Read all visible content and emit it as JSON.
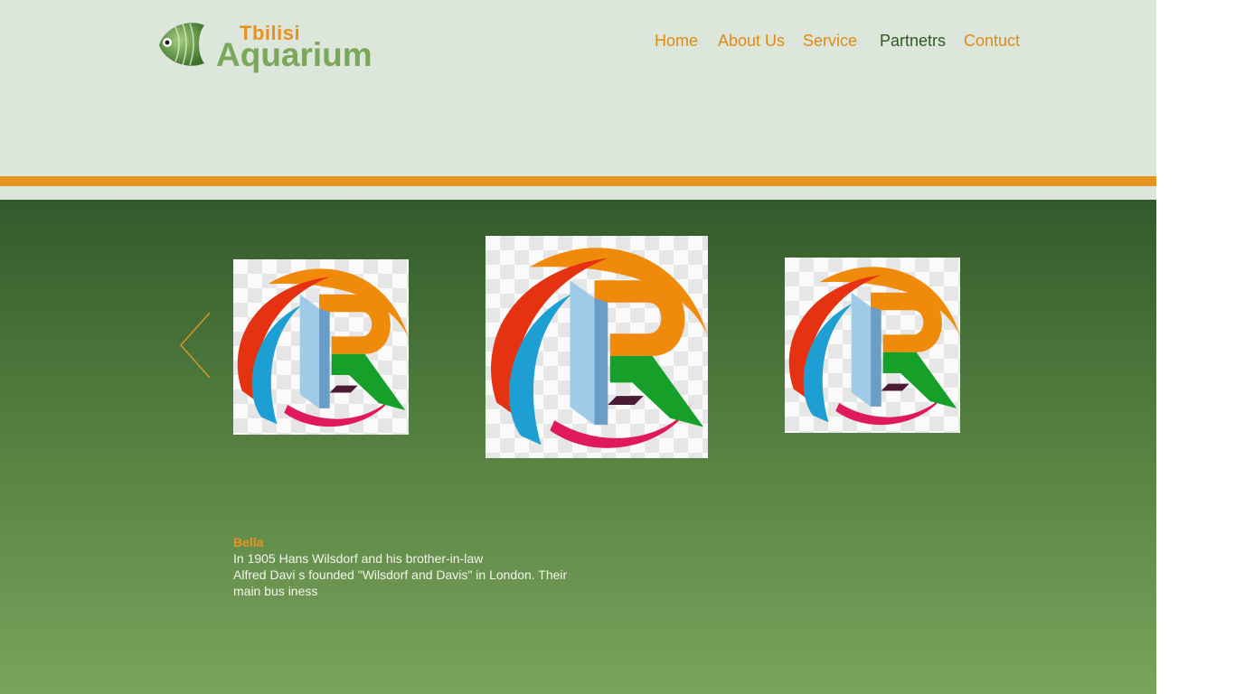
{
  "brand": {
    "top_text": "Tbilisi",
    "main_text": "Aquarium",
    "icon": "fish-icon",
    "colors": {
      "top": "#e8911f",
      "main": "#7aa85a"
    }
  },
  "nav": {
    "items": [
      {
        "label": "Home",
        "active": false
      },
      {
        "label": "About Us",
        "active": false
      },
      {
        "label": "Service",
        "active": false
      },
      {
        "label": "Partnetrs",
        "active": true
      },
      {
        "label": "Contuct",
        "active": false
      }
    ],
    "colors": {
      "default": "#e08a16",
      "active": "#2f5a22"
    }
  },
  "colors": {
    "header_bg": "#dce6da",
    "stripe": "#e6961e",
    "arrow": "#d4982a"
  },
  "carousel": {
    "prev_icon": "chevron-left-icon",
    "slides": [
      {
        "logo_icon": "r-logo-icon"
      },
      {
        "logo_icon": "r-logo-icon"
      },
      {
        "logo_icon": "r-logo-icon"
      }
    ]
  },
  "caption": {
    "name": "Bella",
    "lines": [
      "In 1905 Hans Wilsdorf and his brother-in-law",
      "Alfred Davi s founded \"Wilsdorf and Davis\" in London. Their",
      "main bus iness"
    ],
    "name_color": "#e8911f"
  }
}
